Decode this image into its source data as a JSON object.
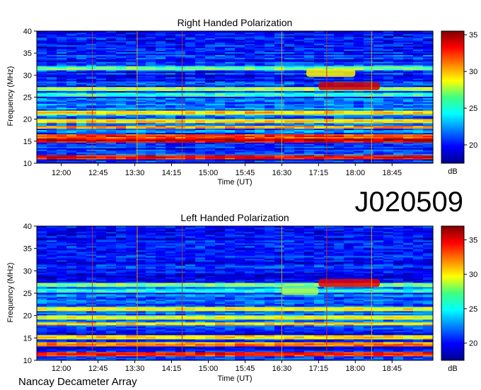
{
  "figure": {
    "observation_id": "J020509",
    "footer": "Nancay Decameter Array"
  },
  "chart_data": [
    {
      "type": "heatmap",
      "title": "Right Handed Polarization",
      "xlabel": "Time (UT)",
      "ylabel": "Frequency (MHz)",
      "x_ticks": [
        "12:00",
        "12:45",
        "13:30",
        "14:15",
        "15:00",
        "15:45",
        "16:30",
        "17:15",
        "18:00",
        "18:45"
      ],
      "y_ticks": [
        10,
        15,
        20,
        25,
        30,
        35,
        40
      ],
      "ylim": [
        10,
        40
      ],
      "colorbar": {
        "label": "dB",
        "ticks": [
          20,
          25,
          30,
          35
        ],
        "range": [
          17.5,
          35.5
        ]
      },
      "features": [
        {
          "kind": "band",
          "freq": 11.5,
          "level": 34
        },
        {
          "kind": "band",
          "freq": 15.3,
          "level": 35
        },
        {
          "kind": "band",
          "freq": 16.2,
          "level": 33
        },
        {
          "kind": "band",
          "freq": 18.2,
          "level": 31
        },
        {
          "kind": "band",
          "freq": 19.5,
          "level": 30
        },
        {
          "kind": "band",
          "freq": 21.5,
          "level": 30
        },
        {
          "kind": "band",
          "freq": 25.5,
          "level": 26
        },
        {
          "kind": "band",
          "freq": 27.0,
          "level": 28
        },
        {
          "kind": "band",
          "freq": 31.5,
          "level": 27
        },
        {
          "kind": "burst",
          "freq": 27.5,
          "time_start": "17:15",
          "time_end": "18:30",
          "level": 34
        },
        {
          "kind": "burst",
          "freq": 30.5,
          "time_start": "17:00",
          "time_end": "18:00",
          "level": 29
        }
      ]
    },
    {
      "type": "heatmap",
      "title": "Left Handed Polarization",
      "xlabel": "Time (UT)",
      "ylabel": "Frequency (MHz)",
      "x_ticks": [
        "12:00",
        "12:45",
        "13:30",
        "14:15",
        "15:00",
        "15:45",
        "16:30",
        "17:15",
        "18:00",
        "18:45"
      ],
      "y_ticks": [
        10,
        15,
        20,
        25,
        30,
        35,
        40
      ],
      "ylim": [
        10,
        40
      ],
      "colorbar": {
        "label": "dB",
        "ticks": [
          20,
          25,
          30,
          35
        ],
        "range": [
          17.5,
          37
        ]
      },
      "features": [
        {
          "kind": "band",
          "freq": 11.5,
          "level": 35
        },
        {
          "kind": "band",
          "freq": 13.5,
          "level": 33
        },
        {
          "kind": "band",
          "freq": 15.3,
          "level": 31
        },
        {
          "kind": "band",
          "freq": 18.2,
          "level": 31
        },
        {
          "kind": "band",
          "freq": 19.5,
          "level": 30
        },
        {
          "kind": "band",
          "freq": 21.5,
          "level": 30
        },
        {
          "kind": "band",
          "freq": 25.5,
          "level": 26
        },
        {
          "kind": "band",
          "freq": 27.0,
          "level": 28
        },
        {
          "kind": "burst",
          "freq": 27.3,
          "time_start": "17:15",
          "time_end": "18:30",
          "level": 35
        },
        {
          "kind": "burst",
          "freq": 25.5,
          "time_start": "16:30",
          "time_end": "17:15",
          "level": 28
        }
      ]
    }
  ]
}
